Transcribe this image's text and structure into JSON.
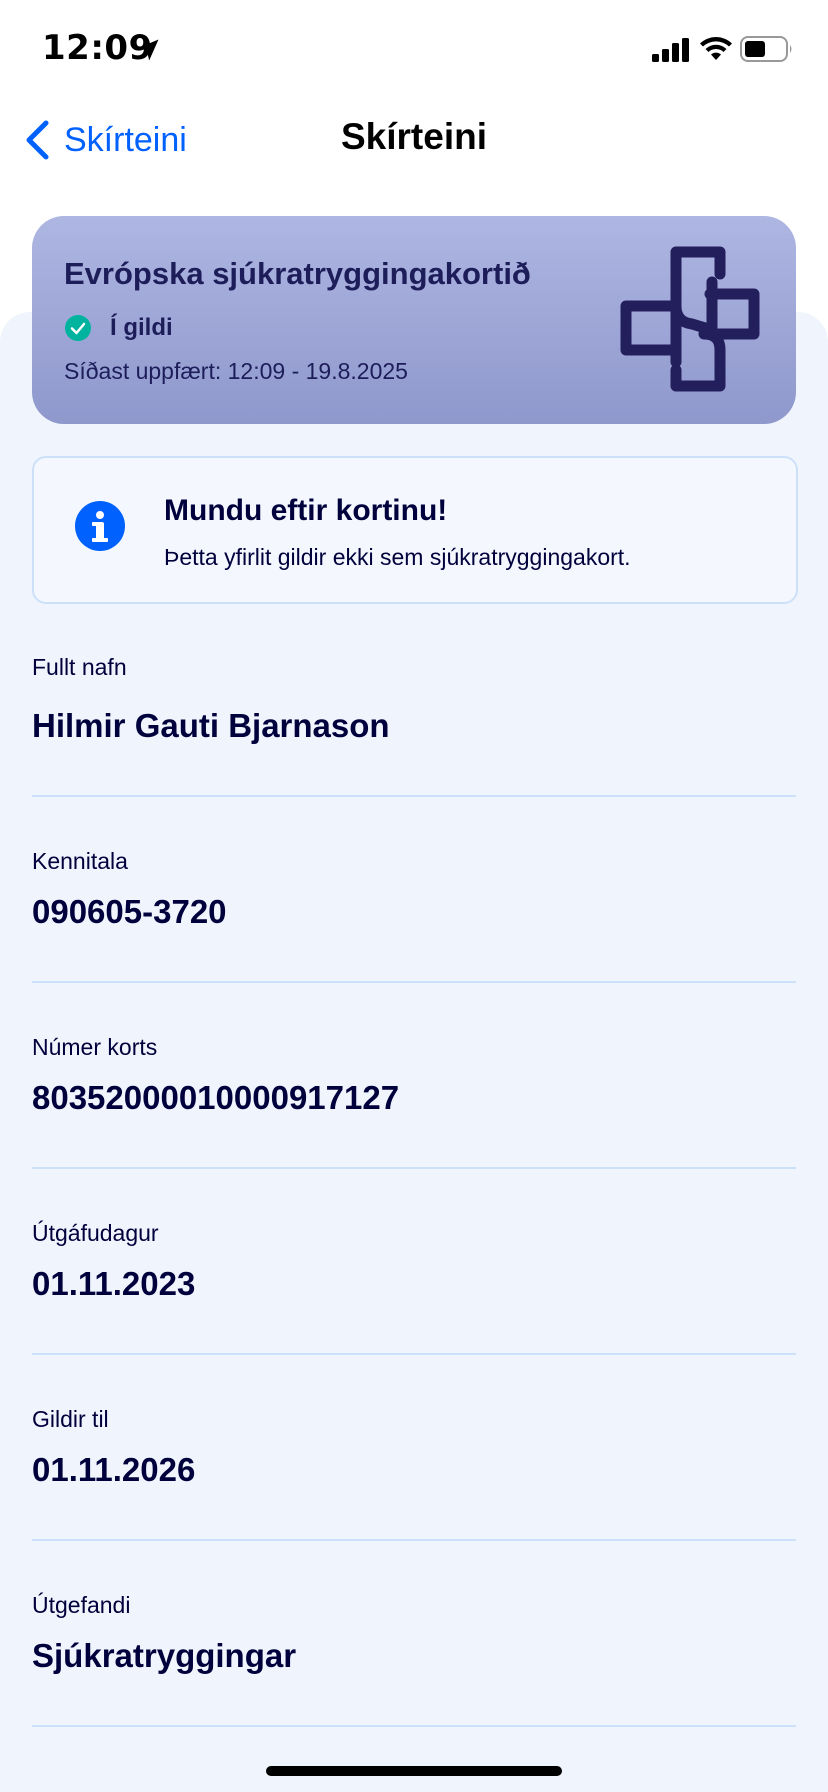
{
  "status_bar": {
    "time": "12:09"
  },
  "nav": {
    "back_label": "Skírteini",
    "title": "Skírteini"
  },
  "card": {
    "title": "Evrópska sjúkratryggingakortið",
    "status": "Í gildi",
    "updated": "Síðast uppfært: 12:09 - 19.8.2025",
    "colors": {
      "gradient_top": "#aeb6e2",
      "gradient_bottom": "#8f98cc",
      "logo": "#231f5c",
      "status_check": "#00b39e"
    }
  },
  "alert": {
    "title": "Mundu eftir kortinu!",
    "text": "Þetta yfirlit gildir ekki sem sjúkratryggingakort.",
    "icon": "info-icon",
    "icon_color": "#0061ff"
  },
  "fields": [
    {
      "label": "Fullt nafn",
      "value": "Hilmir Gauti Bjarnason"
    },
    {
      "label": "Kennitala",
      "value": "090605-3720"
    },
    {
      "label": "Númer korts",
      "value": "80352000010000917127"
    },
    {
      "label": "Útgáfudagur",
      "value": "01.11.2023"
    },
    {
      "label": "Gildir til",
      "value": "01.11.2026"
    },
    {
      "label": "Útgefandi",
      "value": "Sjúkratryggingar"
    }
  ],
  "colors": {
    "accent": "#0061ff",
    "text": "#00003c",
    "background": "#f0f5fd",
    "divider": "#cde0fa"
  }
}
